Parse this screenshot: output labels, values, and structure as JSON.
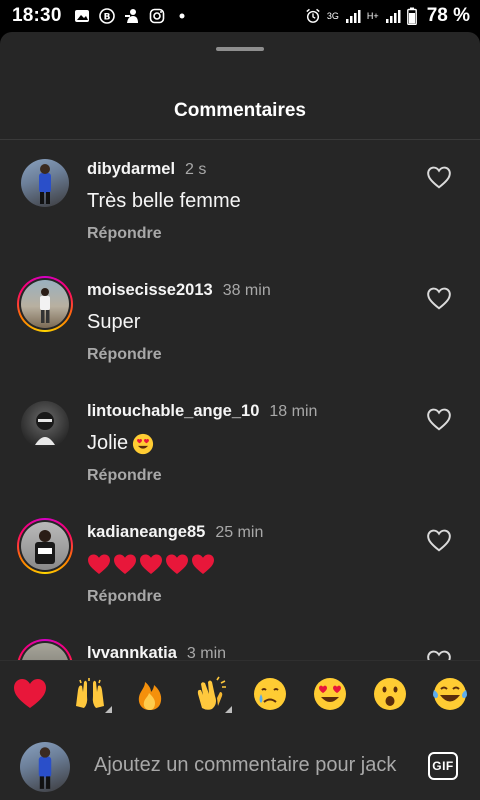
{
  "status_bar": {
    "time": "18:30",
    "left_icons": [
      "image-icon",
      "b-badge-icon",
      "person-icon",
      "instagram-icon",
      "dot-icon"
    ],
    "right_icons": [
      "alarm-icon",
      "network-3g-icon",
      "signal-icon",
      "network-h-icon",
      "signal-icon"
    ],
    "net1": "3G",
    "net2": "H+",
    "battery": "78 %"
  },
  "sheet": {
    "title": "Commentaires"
  },
  "comments": [
    {
      "user": "dibydarmel",
      "time": "2 s",
      "text": "Très belle femme",
      "emoji": [],
      "reply": "Répondre",
      "story_ring": false
    },
    {
      "user": "moisecisse2013",
      "time": "38 min",
      "text": "Super",
      "emoji": [],
      "reply": "Répondre",
      "story_ring": true
    },
    {
      "user": "lintouchable_ange_10",
      "time": "18 min",
      "text": "Jolie",
      "emoji": [
        "heart-eyes-emoji"
      ],
      "reply": "Répondre",
      "story_ring": false
    },
    {
      "user": "kadianeange85",
      "time": "25 min",
      "text": "",
      "emoji": [
        "red-heart-emoji",
        "red-heart-emoji",
        "red-heart-emoji",
        "red-heart-emoji",
        "red-heart-emoji"
      ],
      "reply": "Répondre",
      "story_ring": true
    },
    {
      "user": "lvvannkatia",
      "time": "3 min",
      "text": "",
      "emoji": [],
      "reply": "",
      "story_ring": true
    }
  ],
  "emoji_bar": [
    "red-heart-emoji",
    "raising-hands-emoji",
    "fire-emoji",
    "clapping-hands-emoji",
    "crying-face-emoji",
    "heart-eyes-emoji",
    "surprised-face-emoji",
    "tears-of-joy-emoji"
  ],
  "input": {
    "placeholder": "Ajoutez un commentaire pour jack",
    "gif_label": "GIF"
  },
  "colors": {
    "sheet_bg": "#262626",
    "secondary_text": "#a8a8a8",
    "heart_red": "#e8173a"
  }
}
